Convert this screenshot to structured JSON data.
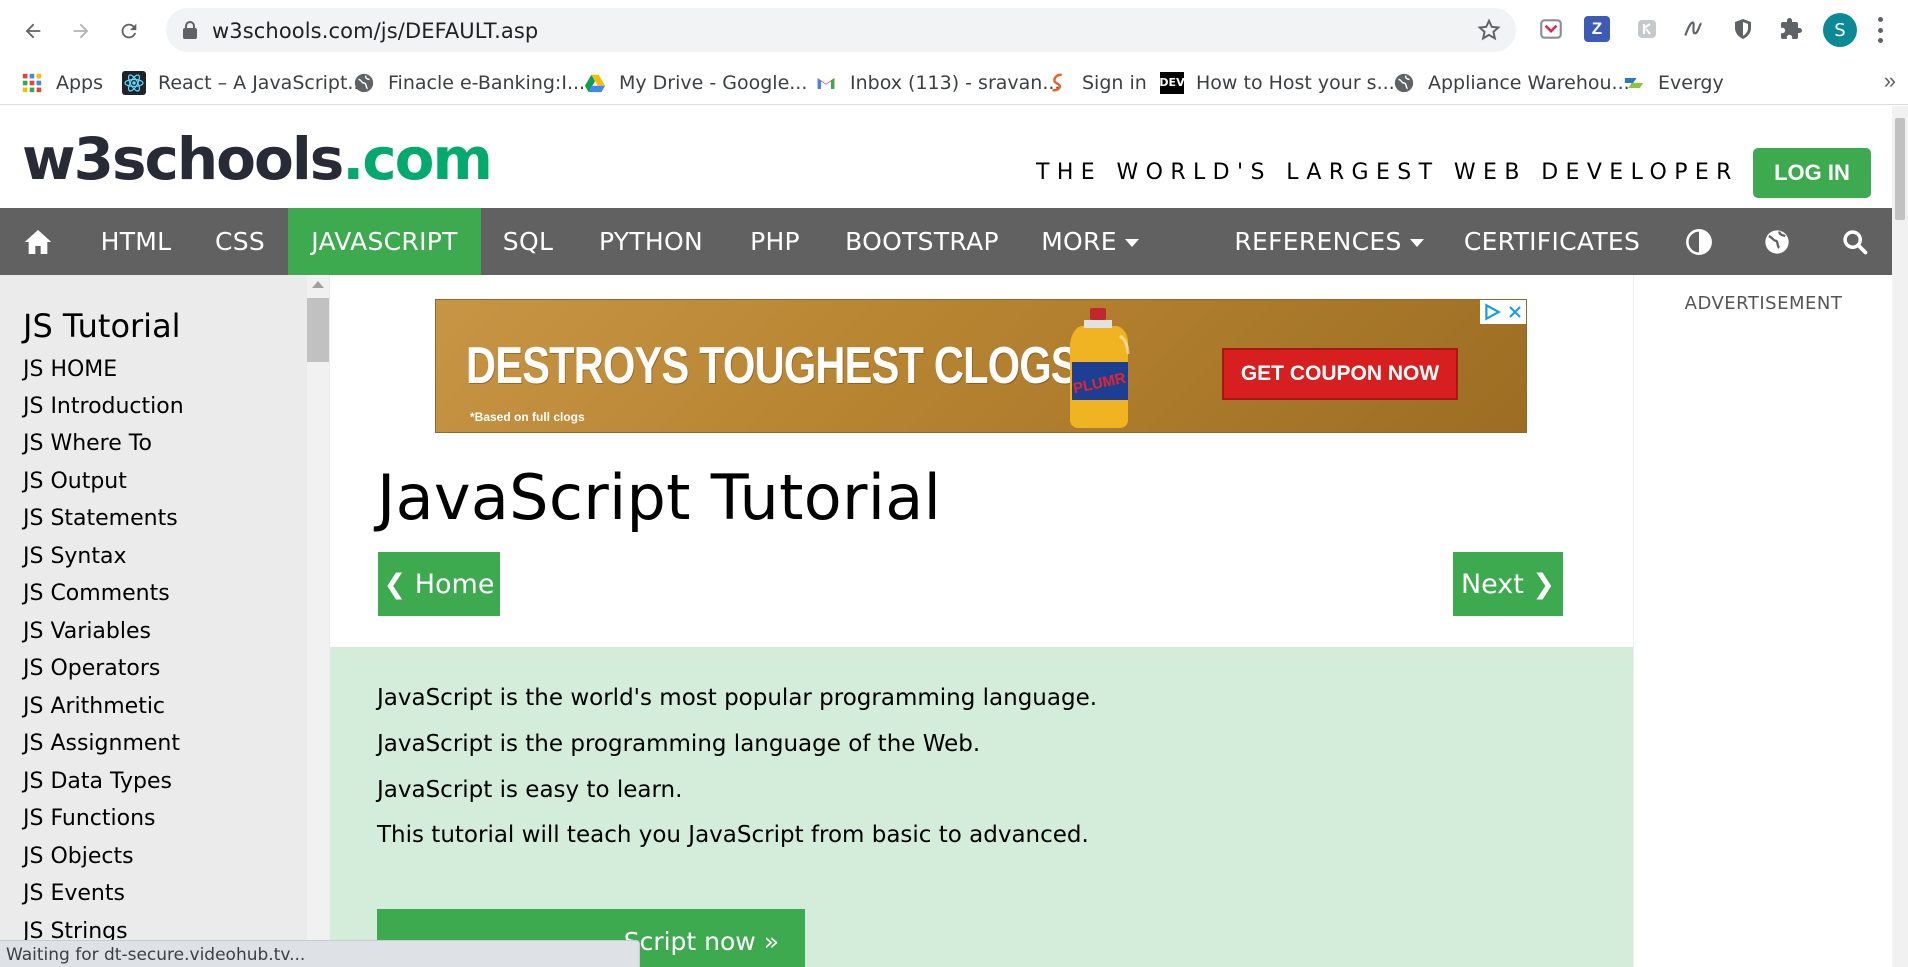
{
  "browser": {
    "url": "w3schools.com/js/DEFAULT.asp",
    "profile_initial": "S",
    "bookmarks": [
      {
        "label": "Apps",
        "icon": "apps-grid-icon"
      },
      {
        "label": "React – A JavaScript...",
        "icon": "react-icon"
      },
      {
        "label": "Finacle e-Banking:I...",
        "icon": "globe-icon"
      },
      {
        "label": "My Drive - Google...",
        "icon": "google-drive-icon"
      },
      {
        "label": "Inbox (113) - sravan...",
        "icon": "gmail-icon"
      },
      {
        "label": "Sign in",
        "icon": "sign-in-icon"
      },
      {
        "label": "How to Host your s...",
        "icon": "dev-icon"
      },
      {
        "label": "Appliance Warehou...",
        "icon": "globe-icon"
      },
      {
        "label": "Evergy",
        "icon": "evergy-icon"
      }
    ],
    "dev_icon_text": "DEV",
    "more_bookmarks": "»",
    "extension_z": "Z",
    "status_text": "Waiting for dt-secure.videohub.tv..."
  },
  "site": {
    "logo_main": "w3schools",
    "logo_tld": ".com",
    "tagline": "THE WORLD'S LARGEST WEB DEVELOPER SITE",
    "login": "LOG IN",
    "nav": {
      "html": "HTML",
      "css": "CSS",
      "javascript": "JAVASCRIPT",
      "sql": "SQL",
      "python": "PYTHON",
      "php": "PHP",
      "bootstrap": "BOOTSTRAP",
      "more": "MORE",
      "references": "REFERENCES",
      "certificates": "CERTIFICATES"
    },
    "accent_green": "#04AA6D",
    "nav_bg": "#616161"
  },
  "sidebar": {
    "title": "JS Tutorial",
    "items": [
      "JS HOME",
      "JS Introduction",
      "JS Where To",
      "JS Output",
      "JS Statements",
      "JS Syntax",
      "JS Comments",
      "JS Variables",
      "JS Operators",
      "JS Arithmetic",
      "JS Assignment",
      "JS Data Types",
      "JS Functions",
      "JS Objects",
      "JS Events",
      "JS Strings"
    ]
  },
  "ad": {
    "headline": "DESTROYS TOUGHEST CLOGS",
    "headline_mark": "*",
    "fineprint": "*Based on full clogs",
    "brand": "PLUMR",
    "cta": "GET COUPON NOW"
  },
  "main": {
    "title": "JavaScript Tutorial",
    "prev": "❮ Home",
    "next": "Next ❯",
    "intro": [
      "JavaScript is the world's most popular programming language.",
      "JavaScript is the programming language of the Web.",
      "JavaScript is easy to learn.",
      "This tutorial will teach you JavaScript from basic to advanced."
    ],
    "start_button": "Script now »"
  },
  "right": {
    "ad_label": "ADVERTISEMENT"
  }
}
